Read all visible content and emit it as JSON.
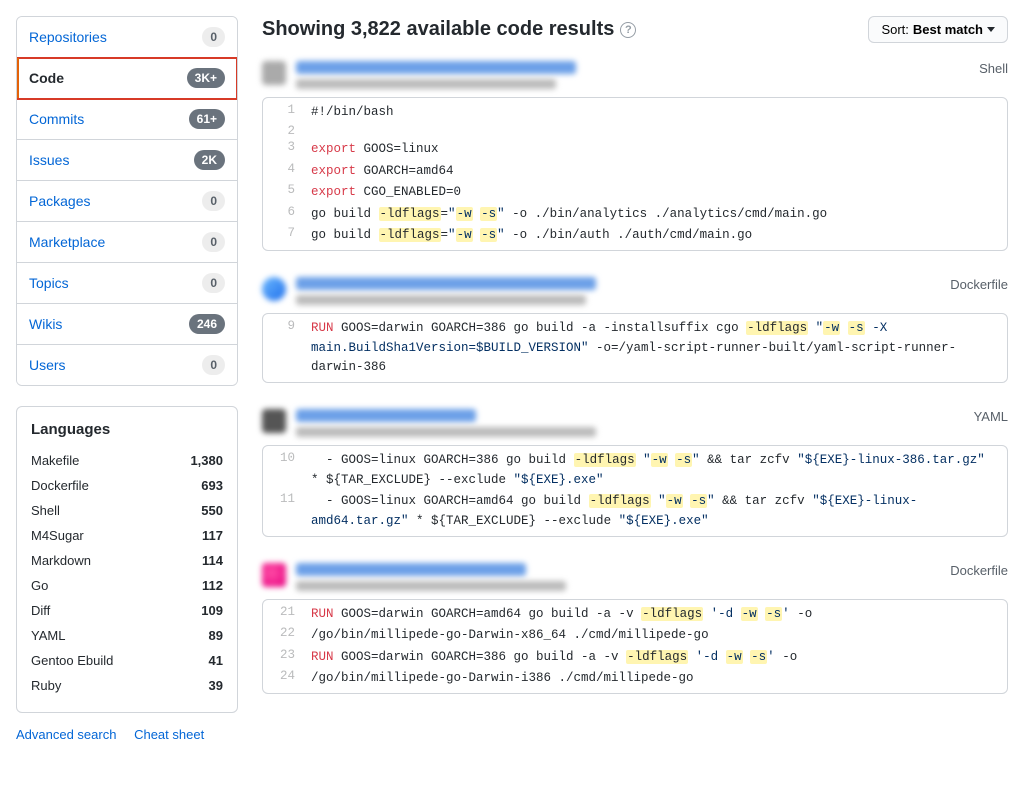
{
  "sidebar": {
    "filters": [
      {
        "label": "Repositories",
        "count": "0",
        "dark": false,
        "active": false
      },
      {
        "label": "Code",
        "count": "3K+",
        "dark": true,
        "active": true,
        "highlighted": true
      },
      {
        "label": "Commits",
        "count": "61+",
        "dark": true,
        "active": false
      },
      {
        "label": "Issues",
        "count": "2K",
        "dark": true,
        "active": false
      },
      {
        "label": "Packages",
        "count": "0",
        "dark": false,
        "active": false
      },
      {
        "label": "Marketplace",
        "count": "0",
        "dark": false,
        "active": false
      },
      {
        "label": "Topics",
        "count": "0",
        "dark": false,
        "active": false
      },
      {
        "label": "Wikis",
        "count": "246",
        "dark": true,
        "active": false
      },
      {
        "label": "Users",
        "count": "0",
        "dark": false,
        "active": false
      }
    ],
    "languages_title": "Languages",
    "languages": [
      {
        "name": "Makefile",
        "count": "1,380"
      },
      {
        "name": "Dockerfile",
        "count": "693"
      },
      {
        "name": "Shell",
        "count": "550"
      },
      {
        "name": "M4Sugar",
        "count": "117"
      },
      {
        "name": "Markdown",
        "count": "114"
      },
      {
        "name": "Go",
        "count": "112"
      },
      {
        "name": "Diff",
        "count": "109"
      },
      {
        "name": "YAML",
        "count": "89"
      },
      {
        "name": "Gentoo Ebuild",
        "count": "41"
      },
      {
        "name": "Ruby",
        "count": "39"
      }
    ],
    "links": {
      "advanced": "Advanced search",
      "cheat": "Cheat sheet"
    }
  },
  "header": {
    "title": "Showing 3,822 available code results",
    "help_char": "?",
    "sort_prefix": "Sort: ",
    "sort_value": "Best match"
  },
  "results": [
    {
      "avatar": "grey",
      "title_width": 280,
      "meta_width": 260,
      "lang": "Shell",
      "lines": [
        {
          "n": "1",
          "html": "#!/bin/bash"
        },
        {
          "n": "2",
          "html": ""
        },
        {
          "n": "3",
          "html": "<span class='kw'>export</span> GOOS=linux"
        },
        {
          "n": "4",
          "html": "<span class='kw'>export</span> GOARCH=amd64"
        },
        {
          "n": "5",
          "html": "<span class='kw'>export</span> CGO_ENABLED=0"
        },
        {
          "n": "6",
          "html": "go build <span class='hl'>-ldflags</span>=<span class='str'>\"<span class='hl'>-w</span> <span class='hl'>-s</span>\"</span> -o ./bin/analytics ./analytics/cmd/main.go"
        },
        {
          "n": "7",
          "html": "go build <span class='hl'>-ldflags</span>=<span class='str'>\"<span class='hl'>-w</span> <span class='hl'>-s</span>\"</span> -o ./bin/auth ./auth/cmd/main.go"
        }
      ]
    },
    {
      "avatar": "blue",
      "title_width": 300,
      "meta_width": 290,
      "lang": "Dockerfile",
      "lines": [
        {
          "n": "9",
          "html": "<span class='kw'>RUN</span> GOOS=darwin GOARCH=386 go build -a -installsuffix cgo <span class='hl'>-ldflags</span> <span class='str'>\"<span class='hl'>-w</span> <span class='hl'>-s</span> -X main.BuildSha1Version=$BUILD_VERSION\"</span> -o=/yaml-script-runner-built/yaml-script-runner-darwin-386"
        }
      ]
    },
    {
      "avatar": "dark",
      "title_width": 180,
      "meta_width": 300,
      "lang": "YAML",
      "lines": [
        {
          "n": "10",
          "html": "  - GOOS=linux GOARCH=386 go build <span class='hl'>-ldflags</span> <span class='str'>\"<span class='hl'>-w</span> <span class='hl'>-s</span>\"</span> &amp;&amp; tar zcfv <span class='str'>\"${EXE}-linux-386.tar.gz\"</span> * ${TAR_EXCLUDE} --exclude <span class='str'>\"${EXE}.exe\"</span>"
        },
        {
          "n": "11",
          "html": "  - GOOS=linux GOARCH=amd64 go build <span class='hl'>-ldflags</span> <span class='str'>\"<span class='hl'>-w</span> <span class='hl'>-s</span>\"</span> &amp;&amp; tar zcfv <span class='str'>\"${EXE}-linux-amd64.tar.gz\"</span> * ${TAR_EXCLUDE} --exclude <span class='str'>\"${EXE}.exe\"</span>"
        }
      ]
    },
    {
      "avatar": "pink",
      "title_width": 230,
      "meta_width": 270,
      "lang": "Dockerfile",
      "lines": [
        {
          "n": "21",
          "html": "<span class='kw'>RUN</span> GOOS=darwin GOARCH=amd64 go build -a -v <span class='hl'>-ldflags</span> <span class='str'>'-d <span class='hl'>-w</span> <span class='hl'>-s</span>'</span> -o"
        },
        {
          "n": "22",
          "html": "/go/bin/millipede-go-Darwin-x86_64 ./cmd/millipede-go"
        },
        {
          "n": "23",
          "html": "<span class='kw'>RUN</span> GOOS=darwin GOARCH=386 go build -a -v <span class='hl'>-ldflags</span> <span class='str'>'-d <span class='hl'>-w</span> <span class='hl'>-s</span>'</span> -o"
        },
        {
          "n": "24",
          "html": "/go/bin/millipede-go-Darwin-i386 ./cmd/millipede-go"
        }
      ]
    }
  ]
}
